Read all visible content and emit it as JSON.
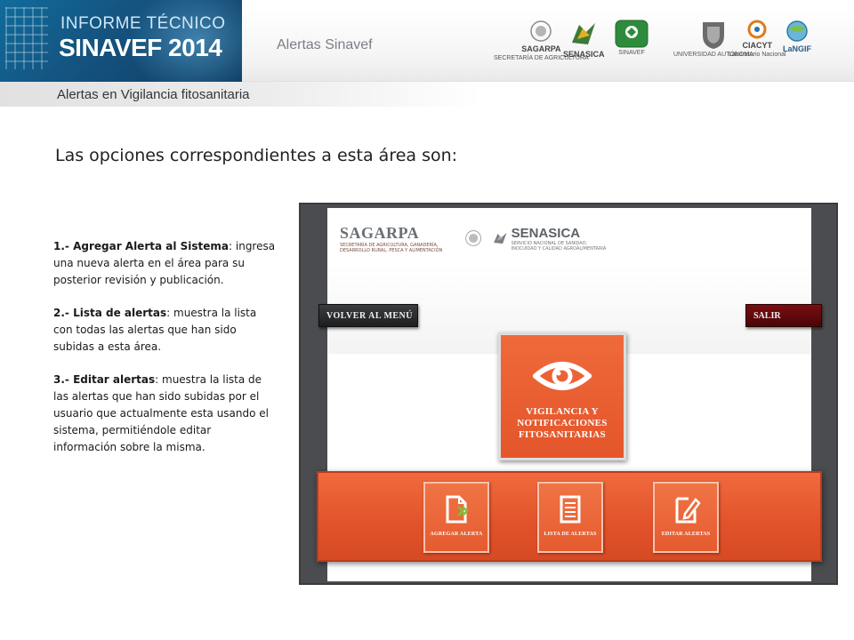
{
  "header": {
    "kicker": "INFORME TÉCNICO",
    "brand": "SINAVEF 2014",
    "section": "Alertas Sinavef",
    "logos": [
      {
        "name": "sagarpa",
        "label": "SAGARPA",
        "caption": "SECRETARÍA DE AGRICULTURA"
      },
      {
        "name": "senasica",
        "label": "SENASICA",
        "caption": ""
      },
      {
        "name": "sinavef",
        "label": "SINAVEF",
        "caption": ""
      },
      {
        "name": "uaslp",
        "label": "",
        "caption": "UNIVERSIDAD AUTÓNOMA"
      },
      {
        "name": "cacyt",
        "label": "CIACYT",
        "caption": "Laboratorio Nacional"
      },
      {
        "name": "langif",
        "label": "LaNGIF",
        "caption": ""
      }
    ]
  },
  "subtitle": "Alertas en Vigilancia fitosanitaria",
  "intro": "Las opciones correspondientes a esta área son:",
  "options": [
    {
      "title": "1.- Agregar Alerta al Sistema",
      "text": ": ingresa una nueva alerta en el área para su posterior revisión y publicación."
    },
    {
      "title": "2.- Lista de alertas",
      "text": ": muestra la lista con todas las alertas que han sido subidas a esta área."
    },
    {
      "title": "3.- Editar alertas",
      "text": ": muestra la lista de las alertas que han sido subidas por el usuario que actualmente esta usando el sistema, permitiéndole editar información sobre la misma."
    }
  ],
  "screenshot": {
    "sagarpa_label": "SAGARPA",
    "sagarpa_caption": "SECRETARÍA DE AGRICULTURA, GANADERÍA, DESARROLLO RURAL, PESCA Y ALIMENTACIÓN",
    "senasica_label": "SENASICA",
    "senasica_caption": "SERVICIO NACIONAL DE SANIDAD, INOCUIDAD Y CALIDAD AGROALIMENTARIA",
    "back_button": "VOLVER AL MENÚ",
    "exit_button": "SALIR",
    "main_tile": "VIGILANCIA Y NOTIFICACIONES FITOSANITARIAS",
    "tiles": [
      {
        "label": "AGREGAR ALERTA",
        "icon": "add-document-icon"
      },
      {
        "label": "LISTA DE ALERTAS",
        "icon": "list-document-icon"
      },
      {
        "label": "EDITAR ALERTAS",
        "icon": "edit-document-icon"
      }
    ]
  },
  "colors": {
    "accent_orange": "#e4552a",
    "exit_red": "#7a0c10",
    "header_blue": "#15527e"
  }
}
